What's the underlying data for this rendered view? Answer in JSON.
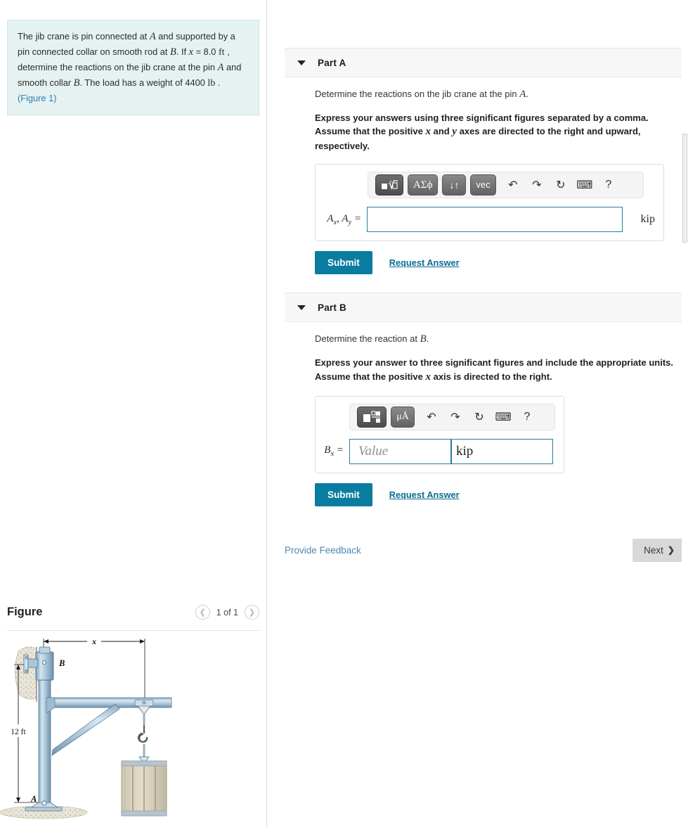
{
  "problem": {
    "text_parts": [
      "The jib crane is pin connected at ",
      "A",
      " and supported by a pin connected collar on smooth rod at ",
      "B",
      ". If ",
      "x",
      " = 8.0 ",
      "ft",
      " , determine the reactions on the jib crane at the pin ",
      "A",
      " and smooth collar ",
      "B",
      ". The load has a weight of 4400 ",
      "lb",
      " ."
    ],
    "figure_link": "(Figure 1)"
  },
  "figure": {
    "title": "Figure",
    "counter": "1 of 1",
    "prev_icon": "chevron-left-icon",
    "next_icon": "chevron-right-icon",
    "labels": {
      "dim_x": "x",
      "dim_height": "12 ft",
      "point_a": "A",
      "point_b": "B"
    }
  },
  "parts": [
    {
      "id": "a",
      "header": "Part A",
      "caret_icon": "caret-down-icon",
      "prompt_pre": "Determine the reactions on the jib crane at the pin ",
      "prompt_var": "A",
      "prompt_post": ".",
      "instructions_line1": "Express your answers using three significant figures separated by a comma.",
      "instructions_line2_pre": "Assume that the positive ",
      "instructions_var1": "x",
      "instructions_line2_mid": " and ",
      "instructions_var2": "y",
      "instructions_line2_post": " axes are directed to the right and upward,",
      "instructions_line3": "respectively.",
      "toolbar": {
        "template_label": "math-template",
        "greek_label": "ΑΣϕ",
        "sort_label": "↓↑",
        "vec_label": "vec",
        "undo_icon": "undo-arrow-icon",
        "redo_icon": "redo-arrow-icon",
        "reset_icon": "reset-circular-arrow-icon",
        "keyboard_icon": "keyboard-icon",
        "help_label": "?"
      },
      "answer_label_main": "A",
      "answer_label_sub1": "x",
      "answer_label_sub2": "y",
      "answer_value": "",
      "unit": "kip",
      "submit_label": "Submit",
      "request_label": "Request Answer"
    },
    {
      "id": "b",
      "header": "Part B",
      "caret_icon": "caret-down-icon",
      "prompt_pre": "Determine the reaction at ",
      "prompt_var": "B",
      "prompt_post": ".",
      "instructions_line1": "Express your answer to three significant figures and include the appropriate units.",
      "instructions_line2_pre": "Assume that the positive ",
      "instructions_var1": "x",
      "instructions_line2_post": " axis is directed to the right.",
      "toolbar": {
        "template_label": "math-fraction-template",
        "units_label": "μÅ",
        "undo_icon": "undo-arrow-icon",
        "redo_icon": "redo-arrow-icon",
        "reset_icon": "reset-circular-arrow-icon",
        "keyboard_icon": "keyboard-icon",
        "help_label": "?"
      },
      "answer_label_main": "B",
      "answer_label_sub1": "x",
      "value_placeholder": "Value",
      "unit_value": "kip",
      "submit_label": "Submit",
      "request_label": "Request Answer"
    }
  ],
  "footer": {
    "feedback_label": "Provide Feedback",
    "next_label": "Next",
    "next_icon": "chevron-right-icon"
  },
  "colors": {
    "accent_teal": "#0a7ca0",
    "link_blue": "#4a87b5",
    "problem_bg": "#e6f2f2",
    "panel_border": "#2a7d99",
    "part_header_bg": "#f7f7f7"
  }
}
